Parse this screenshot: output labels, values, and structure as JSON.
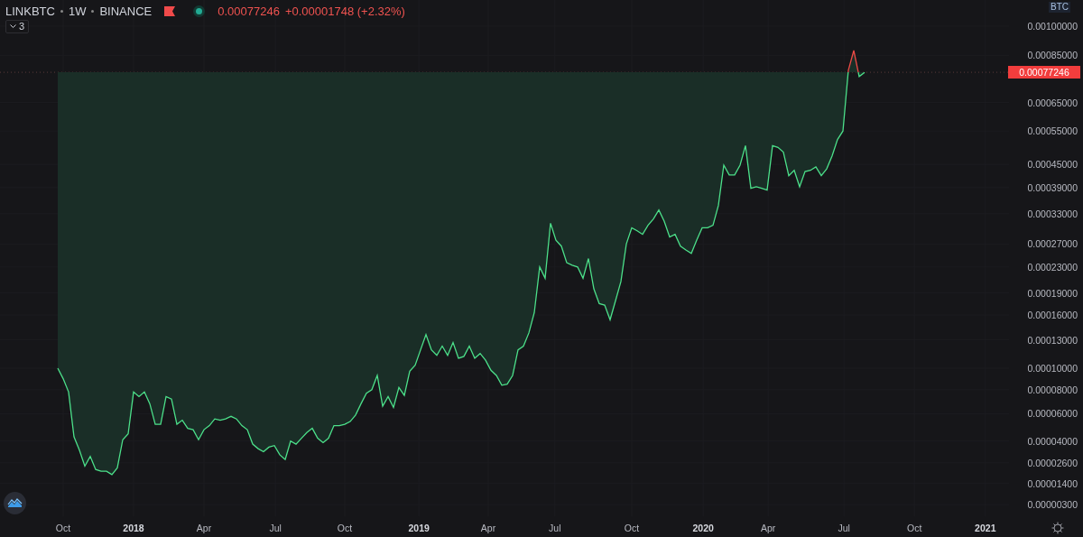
{
  "header": {
    "symbol": "LINKBTC",
    "interval": "1W",
    "exchange": "BINANCE",
    "price": "0.00077246",
    "change": "+0.00001748 (+2.32%)"
  },
  "indicators_toggle": {
    "label": "3"
  },
  "price_axis": {
    "currency": "BTC",
    "last_price_label": "0.00077246",
    "labels": [
      "0.00100000",
      "0.00085000",
      "0.00065000",
      "0.00055000",
      "0.00045000",
      "0.00039000",
      "0.00033000",
      "0.00027000",
      "0.00023000",
      "0.00019000",
      "0.00016000",
      "0.00013000",
      "0.00010000",
      "0.00008000",
      "0.00006000",
      "0.00004000",
      "0.00002600",
      "0.00001400",
      "0.00000300"
    ]
  },
  "time_axis": {
    "labels": [
      {
        "label": "Oct",
        "bold": false
      },
      {
        "label": "2018",
        "bold": true
      },
      {
        "label": "Apr",
        "bold": false
      },
      {
        "label": "Jul",
        "bold": false
      },
      {
        "label": "Oct",
        "bold": false
      },
      {
        "label": "2019",
        "bold": true
      },
      {
        "label": "Apr",
        "bold": false
      },
      {
        "label": "Jul",
        "bold": false
      },
      {
        "label": "Oct",
        "bold": false
      },
      {
        "label": "2020",
        "bold": true
      },
      {
        "label": "Apr",
        "bold": false
      },
      {
        "label": "Jul",
        "bold": false
      },
      {
        "label": "Oct",
        "bold": false
      },
      {
        "label": "2021",
        "bold": true
      }
    ]
  }
}
